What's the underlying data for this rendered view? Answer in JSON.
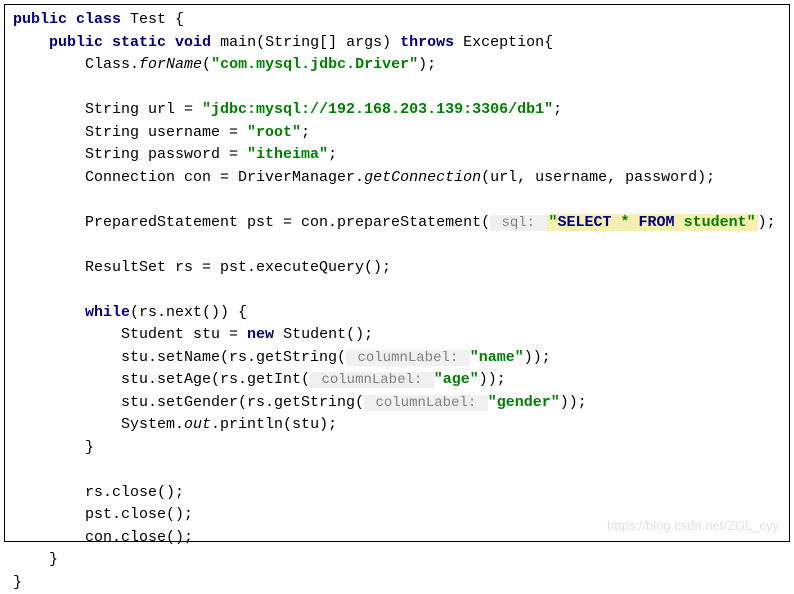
{
  "code": {
    "l1": {
      "kw1": "public",
      "kw2": "class",
      "name": " Test {"
    },
    "l2": {
      "indent": "    ",
      "kw1": "public",
      "kw2": " static",
      "kw3": " void",
      "method": " main(String[] args) ",
      "kw4": "throws",
      "rest": " Exception{"
    },
    "l3": {
      "indent": "        Class.",
      "method": "forName",
      "paren": "(",
      "str": "\"com.mysql.jdbc.Driver\"",
      "end": ");"
    },
    "l4": "",
    "l5": {
      "indent": "        String url = ",
      "str": "\"jdbc:mysql://192.168.203.139:3306/db1\"",
      "end": ";"
    },
    "l6": {
      "indent": "        String username = ",
      "str": "\"root\"",
      "end": ";"
    },
    "l7": {
      "indent": "        String password = ",
      "str": "\"itheima\"",
      "end": ";"
    },
    "l8": {
      "indent": "        Connection con = DriverManager.",
      "method": "getConnection",
      "end": "(url, username, password);"
    },
    "l9": "",
    "l10": {
      "indent": "        PreparedStatement pst = con.prepareStatement(",
      "hint": " sql: ",
      "sql1": "\"",
      "sqlkw1": "SELECT",
      "sqlsp1": " * ",
      "sqlkw2": "FROM",
      "sqltext": " student",
      "sql2": "\"",
      "end": ");"
    },
    "l11": "",
    "l12": {
      "text": "        ResultSet rs = pst.executeQuery();"
    },
    "l13": "",
    "l14": {
      "indent": "        ",
      "kw": "while",
      "rest": "(rs.next()) {"
    },
    "l15": {
      "indent": "            Student stu = ",
      "kw": "new",
      "rest": " Student();"
    },
    "l16": {
      "indent": "            stu.setName(rs.getString(",
      "hint": " columnLabel: ",
      "str": "\"name\"",
      "end": "));"
    },
    "l17": {
      "indent": "            stu.setAge(rs.getInt(",
      "hint": " columnLabel: ",
      "str": "\"age\"",
      "end": "));"
    },
    "l18": {
      "indent": "            stu.setGender(rs.getString(",
      "hint": " columnLabel: ",
      "str": "\"gender\"",
      "end": "));"
    },
    "l19": {
      "indent": "            System.",
      "field": "out",
      "end": ".println(stu);"
    },
    "l20": "        }",
    "l21": "",
    "l22": "        rs.close();",
    "l23": "        pst.close();",
    "l24": "        con.close();",
    "l25": "    }",
    "l26": "}"
  },
  "watermark": "https://blog.csdn.net/ZGL_cyy"
}
